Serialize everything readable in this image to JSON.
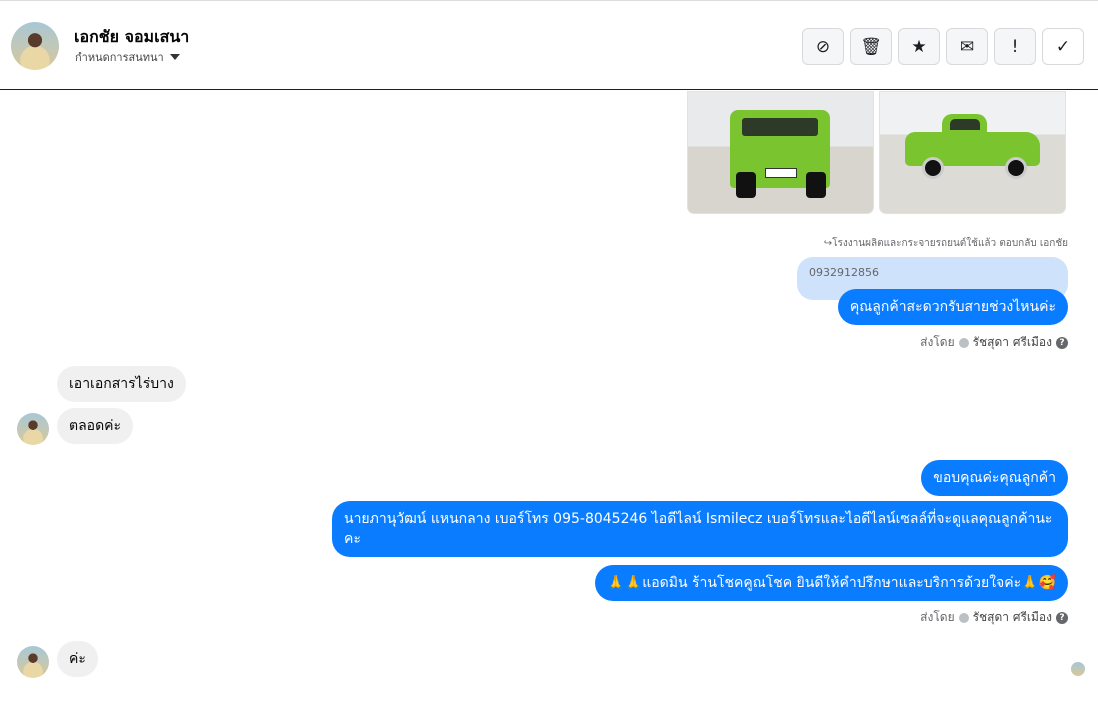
{
  "header": {
    "contact_name": "เอกชัย จอมเสนา",
    "subtitle": "กำหนดการสนทนา",
    "tools": [
      {
        "icon": "spam-alert-icon",
        "glyph": "⊘"
      },
      {
        "icon": "trash-icon",
        "glyph": "🗑"
      },
      {
        "icon": "star-icon",
        "glyph": "★"
      },
      {
        "icon": "envelope-icon",
        "glyph": "✉"
      },
      {
        "icon": "exclamation-icon",
        "glyph": "!"
      },
      {
        "icon": "checkmark-icon",
        "glyph": "✓"
      }
    ]
  },
  "messages": {
    "reply_note": "↪โรงงานผลิตและกระจายรถยนต์ใช้แล้ว ตอบกลับ เอกชัย",
    "quoted_text": "0932912856",
    "out1": "คุณลูกค้าสะดวกรับสายช่วงไหนค่ะ",
    "sent_by_label": "ส่งโดย",
    "agent_name": "รัชสุดา ศรีเมือง",
    "in1": "เอาเอกสารไร่บาง",
    "in2": "ตลอดค่ะ",
    "out2": "ขอบคุณค่ะคุณลูกค้า",
    "out3": "นายภานุวัฒน์ แหนกลาง เบอร์โทร 095-8045246 ไอดีไลน์ Ismilecz   เบอร์โทรและไอดีไลน์เซลล์ที่จะดูแลคุณลูกค้านะคะ",
    "out4": "🙏🙏แอดมิน ร้านโชคคูณโชค ยินดีให้คำปรึกษาและบริการด้วยใจค่ะ🙏🥰",
    "in3": "ค่ะ"
  },
  "colors": {
    "outgoing_bubble": "#0a7cff",
    "incoming_bubble": "#f0f0f0",
    "quoted_bubble": "#cfe2fb"
  }
}
